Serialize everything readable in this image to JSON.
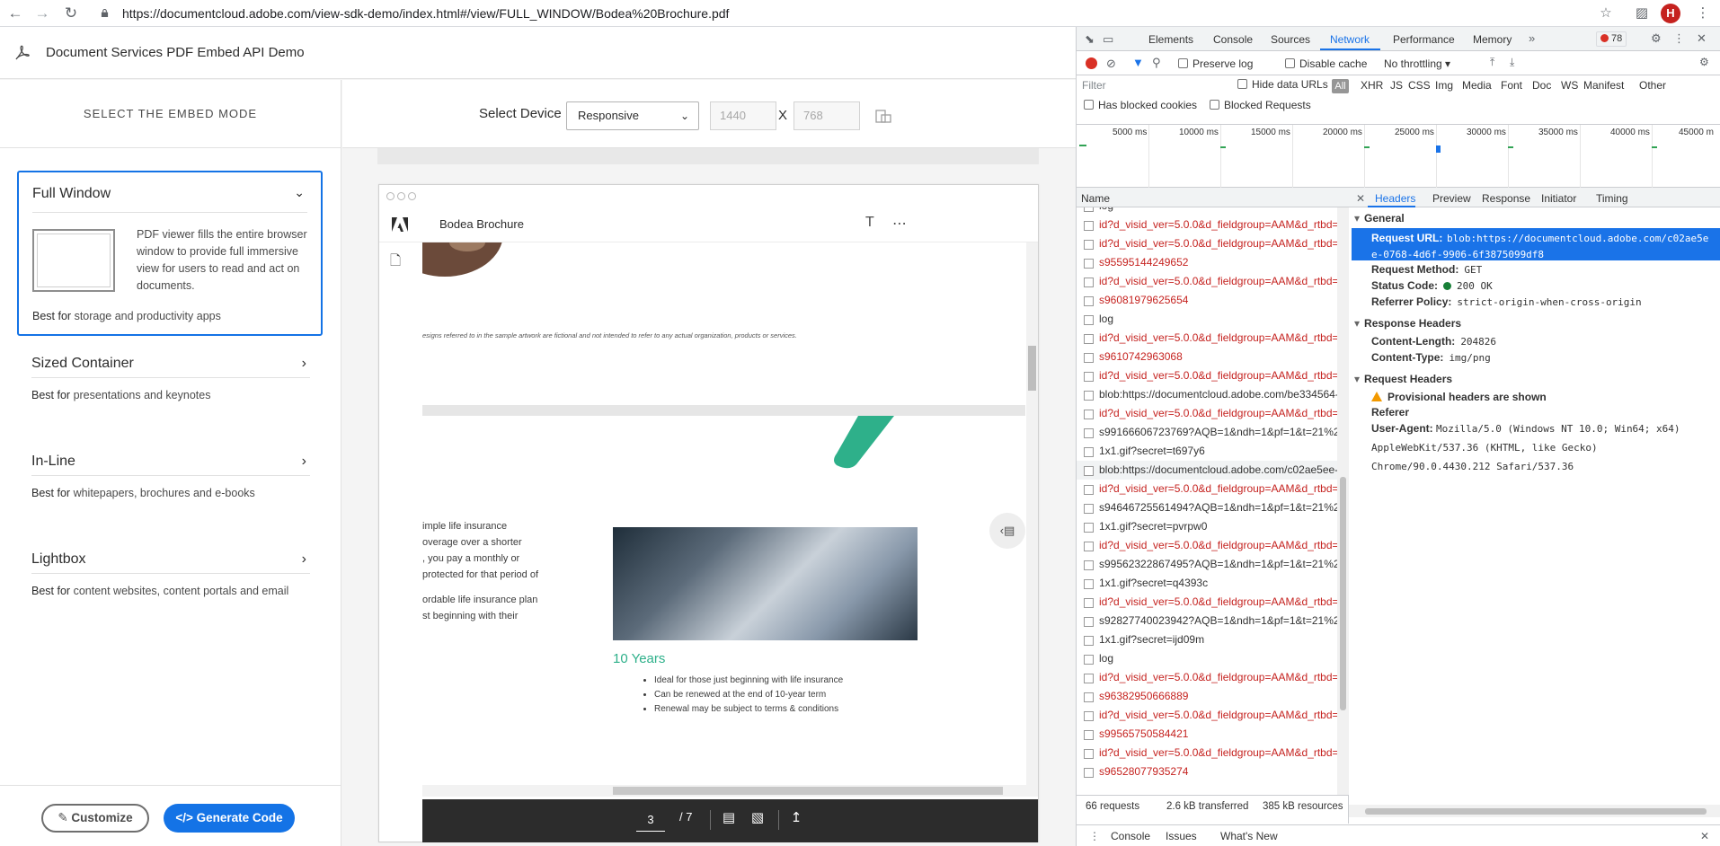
{
  "browser": {
    "url": "https://documentcloud.adobe.com/view-sdk-demo/index.html#/view/FULL_WINDOW/Bodea%20Brochure.pdf",
    "avatar_letter": "H"
  },
  "app": {
    "title": "Document Services PDF Embed API Demo",
    "sidebar_heading": "SELECT THE EMBED MODE",
    "best_for_label": "Best for",
    "modes": [
      {
        "title": "Full Window",
        "description": "PDF viewer fills the entire browser window to provide full immersive view for users to read and act on documents.",
        "best_for": "storage and productivity apps"
      },
      {
        "title": "Sized Container",
        "best_for": "presentations and keynotes"
      },
      {
        "title": "In-Line",
        "best_for": "whitepapers, brochures and e-books"
      },
      {
        "title": "Lightbox",
        "best_for": "content websites, content portals and email"
      }
    ],
    "customize_label": "Customize",
    "generate_label": "Generate Code",
    "device": {
      "label": "Select Device",
      "selected": "Responsive",
      "width": "1440",
      "height": "768",
      "separator": "X"
    }
  },
  "viewer": {
    "doc_title": "Bodea Brochure",
    "current_page": "3",
    "total_pages": "/ 7",
    "disclaimer": "esigns referred to in the sample artwork are fictional and not intended to refer to any actual organization, products or services.",
    "body_para1_lines": [
      "imple life insurance",
      "overage over a shorter",
      ", you pay a monthly or",
      " protected for that period of"
    ],
    "body_para2_lines": [
      "ordable life insurance plan",
      "st beginning with their"
    ],
    "heading": "10 Years",
    "bullets": [
      "Ideal for those just beginning with life insurance",
      "Can be renewed at the end of 10-year term",
      "Renewal may be subject to terms & conditions"
    ]
  },
  "devtools": {
    "tabs": [
      "Elements",
      "Console",
      "Sources",
      "Network",
      "Performance",
      "Memory"
    ],
    "active_tab": "Network",
    "error_count": "78",
    "toolbar": {
      "preserve_log": "Preserve log",
      "disable_cache": "Disable cache",
      "throttling": "No throttling"
    },
    "filter": {
      "placeholder": "Filter",
      "hide_data_urls": "Hide data URLs",
      "all": "All",
      "types": [
        "XHR",
        "JS",
        "CSS",
        "Img",
        "Media",
        "Font",
        "Doc",
        "WS",
        "Manifest",
        "Other"
      ],
      "has_blocked_cookies": "Has blocked cookies",
      "blocked_requests": "Blocked Requests"
    },
    "timeline_ticks": [
      "5000 ms",
      "10000 ms",
      "15000 ms",
      "20000 ms",
      "25000 ms",
      "30000 ms",
      "35000 ms",
      "40000 ms",
      "45000 m"
    ],
    "name_header": "Name",
    "requests": [
      {
        "name": "log",
        "error": false
      },
      {
        "name": "id?d_visid_ver=5.0.0&d_fieldgroup=AAM&d_rtbd=js",
        "error": true
      },
      {
        "name": "id?d_visid_ver=5.0.0&d_fieldgroup=AAM&d_rtbd=js",
        "error": true
      },
      {
        "name": "s95595144249652",
        "error": true
      },
      {
        "name": "id?d_visid_ver=5.0.0&d_fieldgroup=AAM&d_rtbd=js",
        "error": true
      },
      {
        "name": "s96081979625654",
        "error": true
      },
      {
        "name": "log",
        "error": false
      },
      {
        "name": "id?d_visid_ver=5.0.0&d_fieldgroup=AAM&d_rtbd=js",
        "error": true
      },
      {
        "name": "s9610742963068",
        "error": true
      },
      {
        "name": "id?d_visid_ver=5.0.0&d_fieldgroup=AAM&d_rtbd=js",
        "error": true
      },
      {
        "name": "blob:https://documentcloud.adobe.com/be334564-...",
        "error": false
      },
      {
        "name": "id?d_visid_ver=5.0.0&d_fieldgroup=AAM&d_rtbd=js",
        "error": true
      },
      {
        "name": "s99166606723769?AQB=1&ndh=1&pf=1&t=21%2F",
        "error": false
      },
      {
        "name": "1x1.gif?secret=t697y6",
        "error": false
      },
      {
        "name": "blob:https://documentcloud.adobe.com/c02ae5ee-0",
        "error": false,
        "selected": true
      },
      {
        "name": "id?d_visid_ver=5.0.0&d_fieldgroup=AAM&d_rtbd=js",
        "error": true
      },
      {
        "name": "s94646725561494?AQB=1&ndh=1&pf=1&t=21%2F",
        "error": false
      },
      {
        "name": "1x1.gif?secret=pvrpw0",
        "error": false
      },
      {
        "name": "id?d_visid_ver=5.0.0&d_fieldgroup=AAM&d_rtbd=js",
        "error": true
      },
      {
        "name": "s99562322867495?AQB=1&ndh=1&pf=1&t=21%2F",
        "error": false
      },
      {
        "name": "1x1.gif?secret=q4393c",
        "error": false
      },
      {
        "name": "id?d_visid_ver=5.0.0&d_fieldgroup=AAM&d_rtbd=js",
        "error": true
      },
      {
        "name": "s92827740023942?AQB=1&ndh=1&pf=1&t=21%2F",
        "error": false
      },
      {
        "name": "1x1.gif?secret=ijd09m",
        "error": false
      },
      {
        "name": "log",
        "error": false
      },
      {
        "name": "id?d_visid_ver=5.0.0&d_fieldgroup=AAM&d_rtbd=js",
        "error": true
      },
      {
        "name": "s96382950666889",
        "error": true
      },
      {
        "name": "id?d_visid_ver=5.0.0&d_fieldgroup=AAM&d_rtbd=js",
        "error": true
      },
      {
        "name": "s99565750584421",
        "error": true
      },
      {
        "name": "id?d_visid_ver=5.0.0&d_fieldgroup=AAM&d_rtbd=js",
        "error": true
      },
      {
        "name": "s96528077935274",
        "error": true
      }
    ],
    "summary": {
      "requests": "66 requests",
      "transferred": "2.6 kB transferred",
      "resources": "385 kB resources"
    },
    "detail_tabs": [
      "Headers",
      "Preview",
      "Response",
      "Initiator",
      "Timing"
    ],
    "general": {
      "title": "General",
      "request_url_label": "Request URL:",
      "request_url_line1": "blob:https://documentcloud.adobe.com/c02ae5e",
      "request_url_line2": "e-0768-4d6f-9906-6f3875099df8",
      "method_label": "Request Method:",
      "method": "GET",
      "status_label": "Status Code:",
      "status": "200 OK",
      "referrer_label": "Referrer Policy:",
      "referrer": "strict-origin-when-cross-origin"
    },
    "response_headers": {
      "title": "Response Headers",
      "content_length_label": "Content-Length:",
      "content_length": "204826",
      "content_type_label": "Content-Type:",
      "content_type": "img/png"
    },
    "request_headers": {
      "title": "Request Headers",
      "warning": "Provisional headers are shown",
      "referer_label": "Referer",
      "ua_label": "User-Agent:",
      "ua_value": "Mozilla/5.0 (Windows NT 10.0; Win64; x64) AppleWebKit/537.36 (KHTML, like Gecko) Chrome/90.0.4430.212 Safari/537.36"
    },
    "drawer_tabs": [
      "Console",
      "Issues",
      "What's New"
    ]
  }
}
